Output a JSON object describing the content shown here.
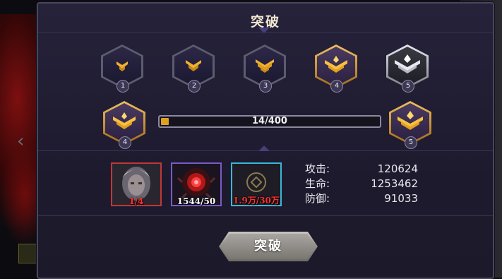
{
  "dialog": {
    "title": "突破",
    "button_label": "突破"
  },
  "ranks": [
    {
      "num": "1",
      "style": "plain"
    },
    {
      "num": "2",
      "style": "plain"
    },
    {
      "num": "3",
      "style": "plain"
    },
    {
      "num": "4",
      "style": "gold"
    },
    {
      "num": "5",
      "style": "silver"
    }
  ],
  "progress": {
    "current_rank": "4",
    "next_rank": "5",
    "text": "14/400",
    "value": 14,
    "max": 400
  },
  "materials": [
    {
      "icon": "hero-portrait-icon",
      "count": "1/4",
      "state": "insufficient",
      "frame": "red"
    },
    {
      "icon": "red-crystal-icon",
      "count": "1544/50",
      "state": "ok",
      "frame": "purple"
    },
    {
      "icon": "gold-coin-icon",
      "count": "1.9万/30万",
      "state": "insufficient",
      "frame": "cyan"
    }
  ],
  "stats": [
    {
      "label": "攻击:",
      "value": "120624"
    },
    {
      "label": "生命:",
      "value": "1253462"
    },
    {
      "label": "防御:",
      "value": "91033"
    }
  ],
  "colors": {
    "gold": "#e0a020",
    "insufficient": "#ff3030",
    "panel": "#221e34"
  }
}
